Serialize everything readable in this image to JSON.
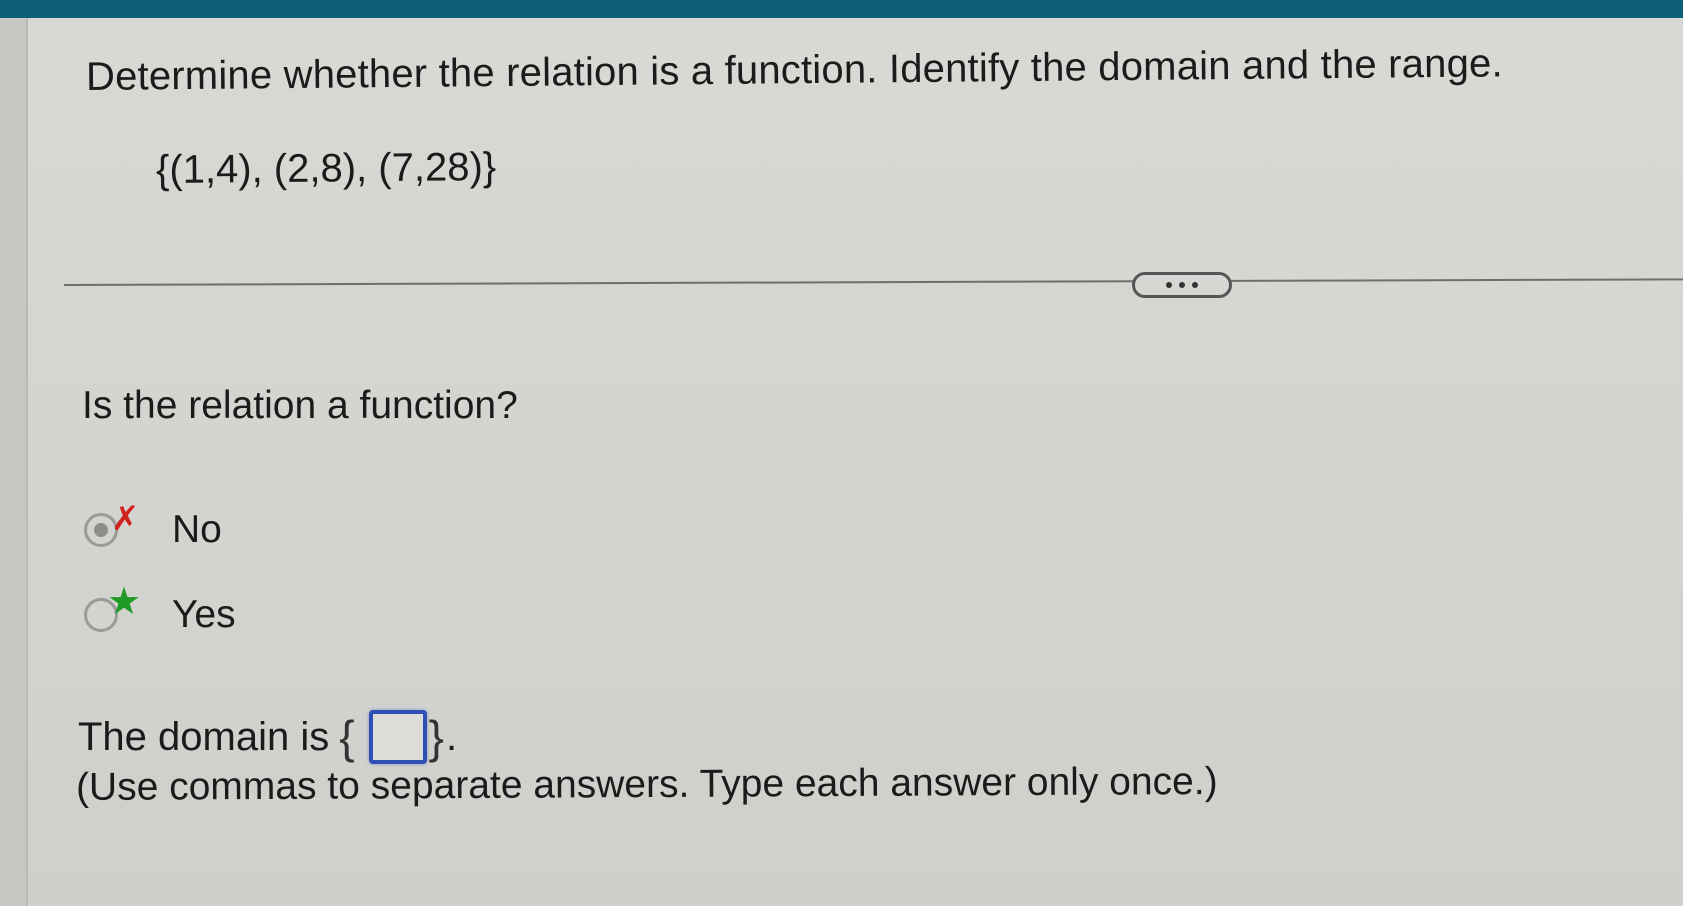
{
  "question": {
    "text": "Determine whether the relation is a function. Identify the domain and the range.",
    "relation": "{(1,4), (2,8), (7,28)}"
  },
  "more_button": {
    "icon": "ellipsis-icon"
  },
  "sub_question": "Is the relation a function?",
  "options": [
    {
      "label": "No",
      "state": "selected-incorrect",
      "mark_icon": "x-icon",
      "mark_color": "#d0221f"
    },
    {
      "label": "Yes",
      "state": "correct-answer",
      "mark_icon": "star-icon",
      "mark_color": "#1f9a24"
    }
  ],
  "domain": {
    "prefix": "The domain is",
    "open_brace": "{",
    "close_brace": "}",
    "period": ".",
    "input_value": "",
    "note": "(Use commas to separate answers. Type each answer only once.)"
  },
  "colors": {
    "header_bar": "#0e5f78",
    "input_border": "#2f4fb5"
  }
}
